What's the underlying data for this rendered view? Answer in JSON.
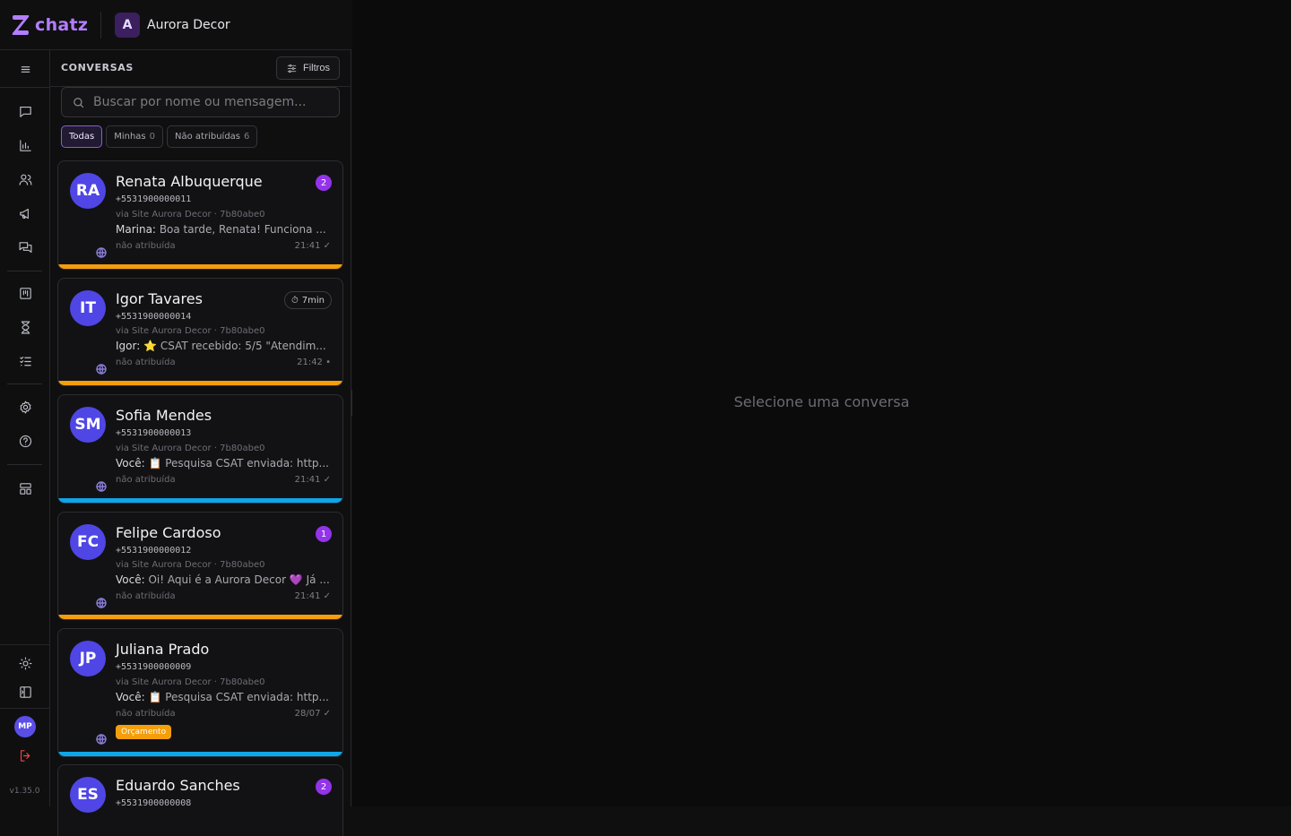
{
  "brand": {
    "name": "chatz",
    "color": "#b27dff"
  },
  "workspace": {
    "initial": "A",
    "name": "Aurora Decor"
  },
  "rail": {
    "user_initials": "MP",
    "version": "v1.35.0",
    "icons": [
      "menu-icon",
      "chat-icon",
      "chart-icon",
      "users-icon",
      "megaphone-icon",
      "messages-icon",
      "kanban-icon",
      "hourglass-icon",
      "checklist-icon",
      "settings-icon",
      "help-icon",
      "layout-icon",
      "sun-icon",
      "sidebar-toggle-icon",
      "logout-icon"
    ]
  },
  "panel": {
    "title": "CONVERSAS",
    "filters_label": "Filtros",
    "search_placeholder": "Buscar por nome ou mensagem...",
    "chips": [
      {
        "label": "Todas",
        "count": ""
      },
      {
        "label": "Minhas",
        "count": "0"
      },
      {
        "label": "Não atribuídas",
        "count": "6"
      }
    ]
  },
  "conversations": [
    {
      "initials": "RA",
      "name": "Renata Albuquerque",
      "phone": "+5531900000011",
      "via": "via Site Aurora Decor · 7b80abe0",
      "sender": "Marina:",
      "message": "Boa tarde, Renata! Funciona ...",
      "assignee": "não atribuída",
      "time": "21:41 ✓",
      "badge": "2",
      "timer": "",
      "tag": "",
      "bar_color": "#f59e0b"
    },
    {
      "initials": "IT",
      "name": "Igor Tavares",
      "phone": "+5531900000014",
      "via": "via Site Aurora Decor · 7b80abe0",
      "sender": "Igor:",
      "message": "⭐ CSAT recebido: 5/5 \"Atendim...",
      "assignee": "não atribuída",
      "time": "21:42 •",
      "badge": "",
      "timer": "7min",
      "tag": "",
      "bar_color": "#f59e0b"
    },
    {
      "initials": "SM",
      "name": "Sofia Mendes",
      "phone": "+5531900000013",
      "via": "via Site Aurora Decor · 7b80abe0",
      "sender": "Você:",
      "message": "📋 Pesquisa CSAT enviada: http...",
      "assignee": "não atribuída",
      "time": "21:41 ✓",
      "badge": "",
      "timer": "",
      "tag": "",
      "bar_color": "#0ea5e9"
    },
    {
      "initials": "FC",
      "name": "Felipe Cardoso",
      "phone": "+5531900000012",
      "via": "via Site Aurora Decor · 7b80abe0",
      "sender": "Você:",
      "message": "Oi! Aqui é a Aurora Decor 💜 Já ...",
      "assignee": "não atribuída",
      "time": "21:41 ✓",
      "badge": "1",
      "timer": "",
      "tag": "",
      "bar_color": "#f59e0b"
    },
    {
      "initials": "JP",
      "name": "Juliana Prado",
      "phone": "+5531900000009",
      "via": "via Site Aurora Decor · 7b80abe0",
      "sender": "Você:",
      "message": "📋 Pesquisa CSAT enviada: http...",
      "assignee": "não atribuída",
      "time": "28/07 ✓",
      "badge": "",
      "timer": "",
      "tag": "Orçamento",
      "bar_color": "#0ea5e9"
    },
    {
      "initials": "ES",
      "name": "Eduardo Sanches",
      "phone": "+5531900000008",
      "via": "",
      "sender": "",
      "message": "",
      "assignee": "",
      "time": "",
      "badge": "2",
      "timer": "",
      "tag": "",
      "bar_color": ""
    }
  ],
  "main": {
    "empty_text": "Selecione uma conversa"
  }
}
